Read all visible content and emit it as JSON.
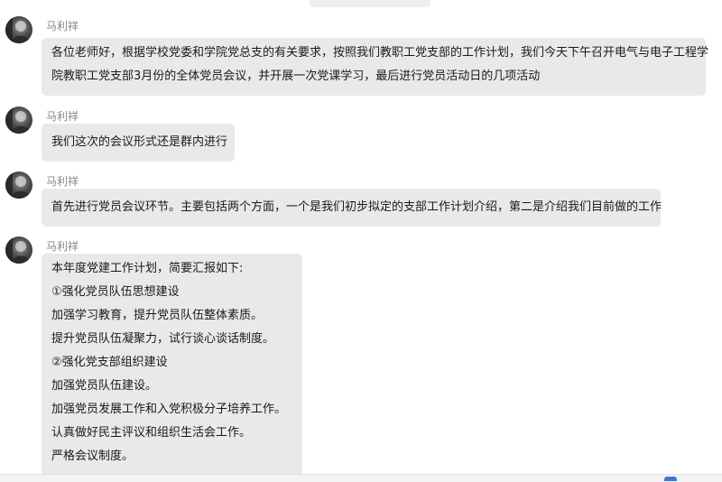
{
  "messages": [
    {
      "sender": "马利祥",
      "lines": [
        "各位老师好，根据学校党委和学院党总支的有关要求，按照我们教职工党支部的工作计划，我们今天下午召开电气与电子工程学",
        "院教职工党支部3月份的全体党员会议，并开展一次党课学习，最后进行党员活动日的几项活动"
      ]
    },
    {
      "sender": "马利祥",
      "lines": [
        "我们这次的会议形式还是群内进行"
      ]
    },
    {
      "sender": "马利祥",
      "lines": [
        "首先进行党员会议环节。主要包括两个方面，一个是我们初步拟定的支部工作计划介绍，第二是介绍我们目前做的工作"
      ]
    },
    {
      "sender": "马利祥",
      "lines": [
        "本年度党建工作计划，简要汇报如下:",
        "①强化党员队伍思想建设",
        "加强学习教育，提升党员队伍整体素质。",
        "提升党员队伍凝聚力，试行谈心谈话制度。",
        "②强化党支部组织建设",
        "加强党员队伍建设。",
        "加强党员发展工作和入党积极分子培养工作。",
        "认真做好民主评议和组织生活会工作。",
        "严格会议制度。"
      ]
    }
  ],
  "colors": {
    "bubble": "#e9e9e9",
    "sender": "#888888",
    "text": "#1a1a1a",
    "background": "#ffffff"
  },
  "icons": {
    "avatar": "user-avatar-photo"
  }
}
